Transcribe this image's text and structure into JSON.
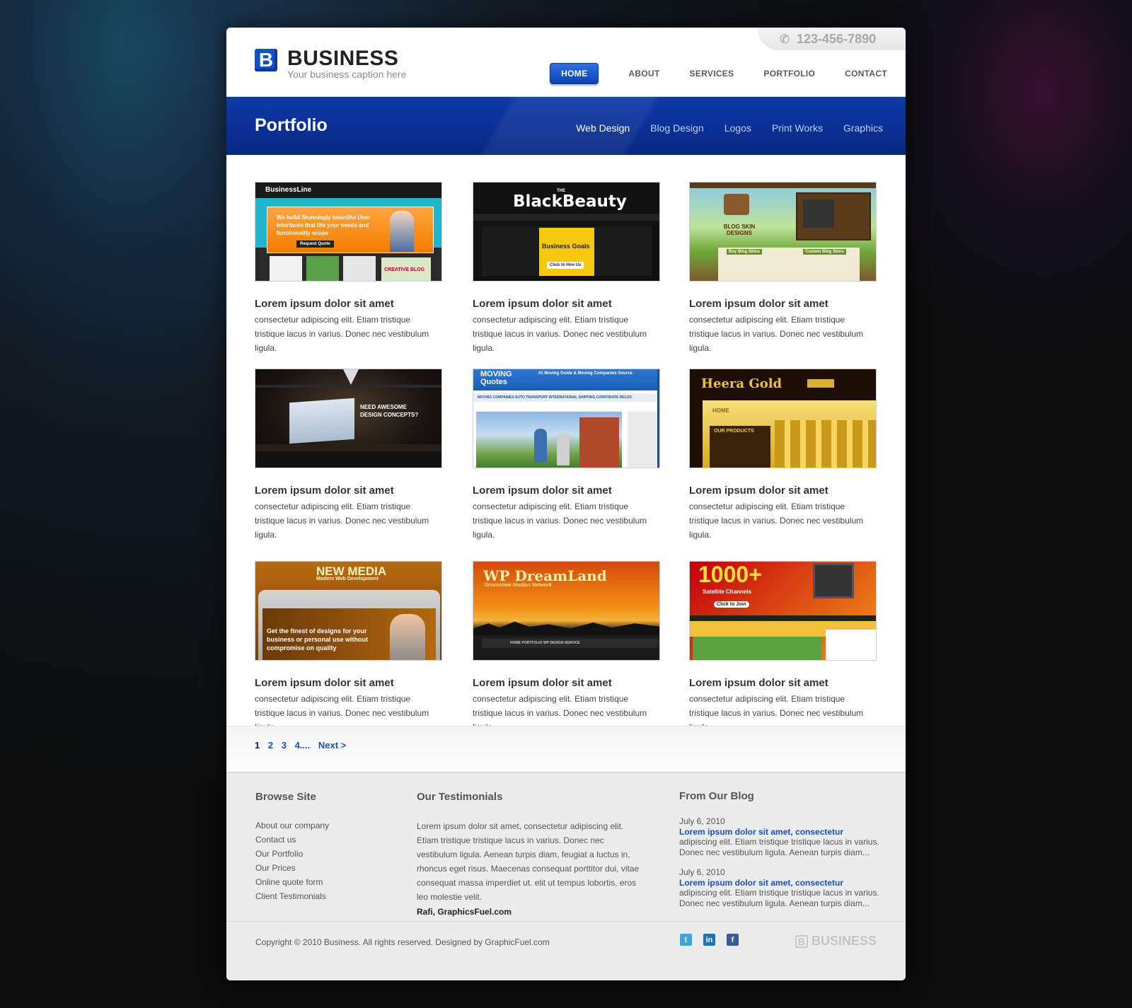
{
  "header": {
    "logo_mark": "B",
    "brand": "BUSINESS",
    "caption": "Your business caption here",
    "phone": "123-456-7890",
    "nav": [
      {
        "label": "HOME",
        "active": true
      },
      {
        "label": "ABOUT"
      },
      {
        "label": "SERVICES"
      },
      {
        "label": "PORTFOLIO"
      },
      {
        "label": "CONTACT"
      }
    ]
  },
  "banner": {
    "title": "Portfolio",
    "categories": [
      "Web Design",
      "Blog Design",
      "Logos",
      "Print Works",
      "Graphics"
    ]
  },
  "portfolio": {
    "items": [
      {
        "thumb_label": "BusinessLine",
        "thumb_headline": "We build Stunningly beautiful User Interfaces that fits your needs and functionality scope",
        "thumb_button": "Request Quote",
        "thumb_tag": "CREATIVE BLOG",
        "title": "Lorem ipsum dolor sit amet",
        "text": "consectetur adipiscing elit. Etiam tristique tristique lacus in varius. Donec nec vestibulum ligula."
      },
      {
        "thumb_label": "BlackBeauty",
        "thumb_kicker": "THE",
        "thumb_sub": "Business Goals",
        "thumb_button": "Click to Hire Us",
        "title": "Lorem ipsum dolor sit amet",
        "text": "consectetur adipiscing elit. Etiam tristique tristique lacus in varius. Donec nec vestibulum ligula."
      },
      {
        "thumb_label": "BLOG SKIN DESIGNS",
        "thumb_sub": "Buy Blog Skins",
        "thumb_tag": "Custom Blog Skins",
        "title": "Lorem ipsum dolor sit amet",
        "text": "consectetur adipiscing elit. Etiam tristique tristique lacus in varius. Donec nec vestibulum ligula."
      },
      {
        "thumb_label": "NEED AWESOME DESIGN CONCEPTS?",
        "title": "Lorem ipsum dolor sit amet",
        "text": "consectetur adipiscing elit. Etiam tristique tristique lacus in varius. Donec nec vestibulum ligula."
      },
      {
        "thumb_label": "MOVING Quotes",
        "thumb_sub": "#1 Moving Guide & Moving Companies Source",
        "thumb_nav": "MOVING COMPANIES   AUTO TRANSPORT   INTERNATIONAL SHIPPING   CORPORATE RELOC",
        "title": "Lorem ipsum dolor sit amet",
        "text": "consectetur adipiscing elit. Etiam tristique tristique lacus in varius. Donec nec vestibulum ligula."
      },
      {
        "thumb_label": "Heera Gold",
        "thumb_sub": "OUR PRODUCTS",
        "thumb_tag": "HOME",
        "title": "Lorem ipsum dolor sit amet",
        "text": "consectetur adipiscing elit. Etiam tristique tristique lacus in varius. Donec nec vestibulum ligula."
      },
      {
        "thumb_label": "NEW MEDIA",
        "thumb_sub": "Modern Web Development",
        "thumb_headline": "Get the finest of designs for your business or personal use without compromise on quality",
        "title": "Lorem ipsum dolor sit amet",
        "text": "consectetur adipiscing elit. Etiam tristique tristique lacus in varius. Donec nec vestibulum ligula."
      },
      {
        "thumb_label": "WP DreamLand",
        "thumb_sub": "DreamView Studios Network",
        "thumb_nav": "HOME   PORTFOLIO   WP DESIGN SERVICE",
        "title": "Lorem ipsum dolor sit amet",
        "text": "consectetur adipiscing elit. Etiam tristique tristique lacus in varius. Donec nec vestibulum ligula."
      },
      {
        "thumb_label": "1000+",
        "thumb_sub": "Satellite Channels",
        "thumb_button": "Click to Join",
        "title": "Lorem ipsum dolor sit amet",
        "text": "consectetur adipiscing elit. Etiam tristique tristique lacus in varius. Donec nec vestibulum ligula."
      }
    ]
  },
  "pagination": {
    "pages": [
      "1",
      "2",
      "3",
      "4...."
    ],
    "next": "Next >"
  },
  "footer": {
    "browse": {
      "title": "Browse Site",
      "links": [
        "About our company",
        "Contact us",
        "Our Portfolio",
        "Our Prices",
        "Online quote form",
        "Client Testimonials"
      ]
    },
    "testimonials": {
      "title": "Our Testimonials",
      "text": "Lorem ipsum dolor sit amet, consectetur adipiscing elit. Etiam tristique tristique lacus in varius. Donec nec vestibulum ligula. Aenean turpis diam, feugiat a luctus in, rhoncus eget risus. Maecenas consequat porttitor dui, vitae consequat massa imperdiet ut. elit ut tempus lobortis, eros leo molestie velit.",
      "author": "Rafi, GraphicsFuel.com"
    },
    "blog": {
      "title": "From Our Blog",
      "posts": [
        {
          "date": "July 6, 2010",
          "title": "Lorem ipsum dolor sit amet, consectetur",
          "excerpt": "adipiscing elit. Etiam tristique tristique lacus in varius. Donec nec vestibulum ligula. Aenean turpis diam..."
        },
        {
          "date": "July 6, 2010",
          "title": "Lorem ipsum dolor sit amet, consectetur",
          "excerpt": "adipiscing elit. Etiam tristique tristique lacus in varius. Donec nec vestibulum ligula. Aenean turpis diam..."
        }
      ]
    },
    "copyright": "Copyright © 2010 Business. All rights reserved. Designed by GraphicFuel.com",
    "social": [
      {
        "name": "twitter-icon",
        "glyph": "t",
        "color": "#3aa6dd"
      },
      {
        "name": "linkedin-icon",
        "glyph": "in",
        "color": "#1b75b5"
      },
      {
        "name": "facebook-icon",
        "glyph": "f",
        "color": "#3b5a9a"
      }
    ],
    "logo_mark": "B",
    "logo_name": "BUSINESS"
  },
  "colors": {
    "accent": "#1550c4",
    "banner": "#0a2f93"
  }
}
